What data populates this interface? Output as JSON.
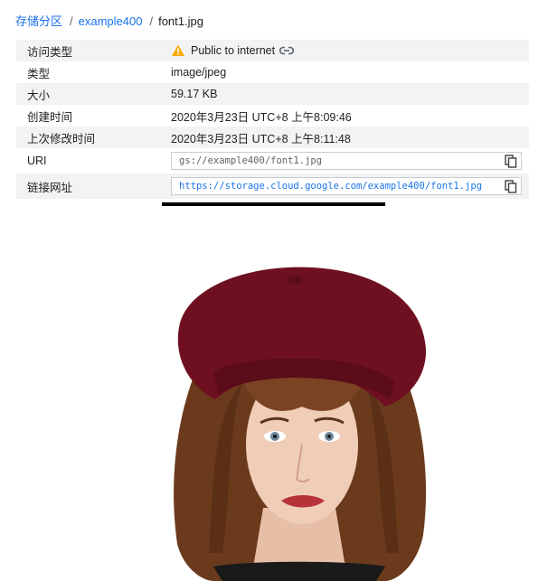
{
  "breadcrumb": {
    "items": [
      "存储分区",
      "example400",
      "font1.jpg"
    ],
    "separator": "/"
  },
  "details": {
    "rows": [
      {
        "label": "访问类型",
        "value": "Public to internet"
      },
      {
        "label": "类型",
        "value": "image/jpeg"
      },
      {
        "label": "大小",
        "value": "59.17 KB"
      },
      {
        "label": "创建时间",
        "value": "2020年3月23日 UTC+8 上午8:09:46"
      },
      {
        "label": "上次修改时间",
        "value": "2020年3月23日 UTC+8 上午8:11:48"
      },
      {
        "label": "URI",
        "value": "gs://example400/font1.jpg"
      },
      {
        "label": "链接网址",
        "value": "https://storage.cloud.google.com/example400/font1.jpg"
      }
    ]
  },
  "icons": {
    "access_warning": "warning-icon",
    "public_link": "link-icon",
    "copy": "copy-icon"
  },
  "colors": {
    "link": "#1a73e8",
    "warning": "#f9ab00",
    "row_stripe": "#f1f3f4",
    "beret": "#6e1020",
    "hair": "#6b3a1c"
  }
}
